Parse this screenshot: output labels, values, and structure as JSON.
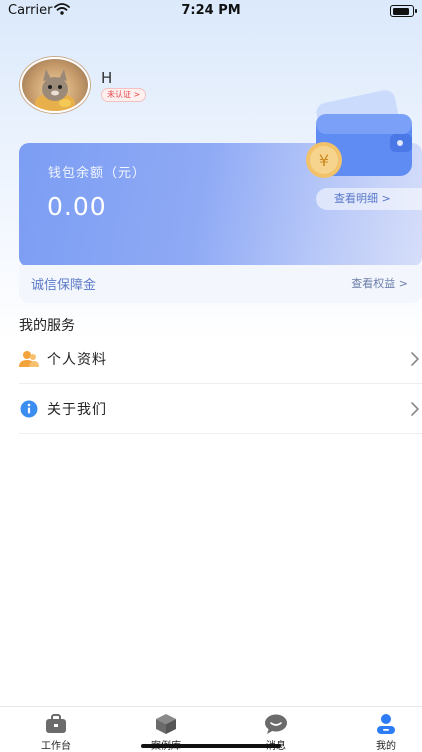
{
  "status_bar": {
    "carrier": "Carrier",
    "time": "7:24 PM",
    "battery_level": 0.85
  },
  "profile": {
    "name": "H",
    "verify_badge": "未认证 >"
  },
  "wallet": {
    "label": "钱包余额（元）",
    "amount": "0.00",
    "detail_button": "查看明细  >",
    "currency_icon": "yuan-coin-icon"
  },
  "guarantee": {
    "label": "诚信保障金",
    "rights_link": "查看权益  >"
  },
  "services": {
    "title": "我的服务",
    "items": [
      {
        "label": "个人资料",
        "icon": "person-icon",
        "icon_color": "#f3a33c"
      },
      {
        "label": "关于我们",
        "icon": "info-icon",
        "icon_color": "#3b8df0"
      }
    ]
  },
  "tab_bar": {
    "tabs": [
      {
        "label": "工作台",
        "icon": "briefcase-icon",
        "active": false
      },
      {
        "label": "案例库",
        "icon": "box-icon",
        "active": false
      },
      {
        "label": "消息",
        "icon": "chat-icon",
        "active": false
      },
      {
        "label": "我的",
        "icon": "user-icon",
        "active": true
      }
    ]
  },
  "colors": {
    "accent": "#2d7cf6",
    "tab_inactive": "#6b6b6b",
    "card_start": "#7b9df3",
    "card_end": "#d6def9",
    "badge_text": "#e6474a"
  }
}
